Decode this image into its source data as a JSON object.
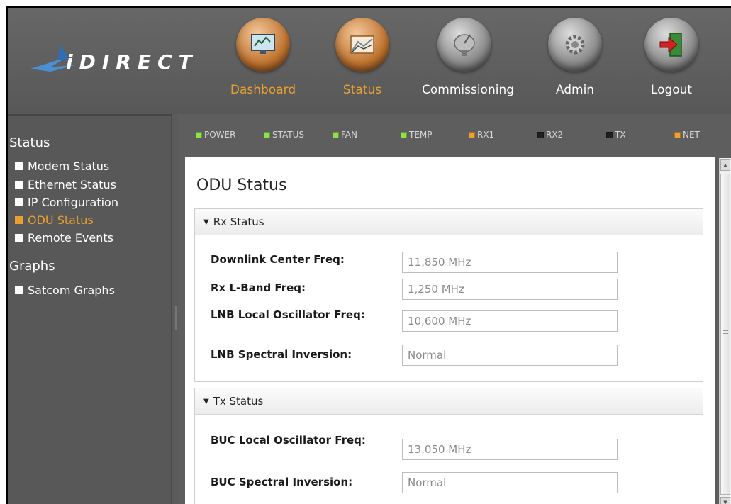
{
  "logo": {
    "text": "iDIRECT"
  },
  "nav": [
    {
      "label": "Dashboard",
      "active": true,
      "icon": "dashboard-monitor-icon"
    },
    {
      "label": "Status",
      "active": true,
      "icon": "status-graph-icon"
    },
    {
      "label": "Commissioning",
      "active": false,
      "icon": "satellite-dish-icon"
    },
    {
      "label": "Admin",
      "active": false,
      "icon": "gear-icon"
    },
    {
      "label": "Logout",
      "active": false,
      "icon": "exit-door-icon"
    }
  ],
  "sidebar": {
    "status_heading": "Status",
    "items": [
      {
        "label": "Modem Status"
      },
      {
        "label": "Ethernet Status"
      },
      {
        "label": "IP Configuration"
      },
      {
        "label": "ODU Status"
      },
      {
        "label": "Remote Events"
      }
    ],
    "graphs_heading": "Graphs",
    "graph_items": [
      {
        "label": "Satcom Graphs"
      }
    ]
  },
  "leds": [
    {
      "label": "POWER",
      "color": "#8fe04a"
    },
    {
      "label": "STATUS",
      "color": "#8fe04a"
    },
    {
      "label": "FAN",
      "color": "#8fe04a"
    },
    {
      "label": "TEMP",
      "color": "#8fe04a"
    },
    {
      "label": "RX1",
      "color": "#f0a030"
    },
    {
      "label": "RX2",
      "color": "#202020"
    },
    {
      "label": "TX",
      "color": "#202020"
    },
    {
      "label": "NET",
      "color": "#f0a030"
    }
  ],
  "page_title": "ODU Status",
  "rx": {
    "header": "Rx Status",
    "fields": [
      {
        "label": "Downlink Center Freq:",
        "value": "11,850 MHz"
      },
      {
        "label": "Rx L-Band Freq:",
        "value": "1,250 MHz"
      },
      {
        "label": "LNB Local Oscillator Freq:",
        "value": "10,600 MHz"
      },
      {
        "label": "LNB Spectral Inversion:",
        "value": "Normal"
      }
    ]
  },
  "tx": {
    "header": "Tx Status",
    "fields": [
      {
        "label": "BUC Local Oscillator Freq:",
        "value": "13,050 MHz"
      },
      {
        "label": "BUC Spectral Inversion:",
        "value": "Normal"
      }
    ]
  }
}
